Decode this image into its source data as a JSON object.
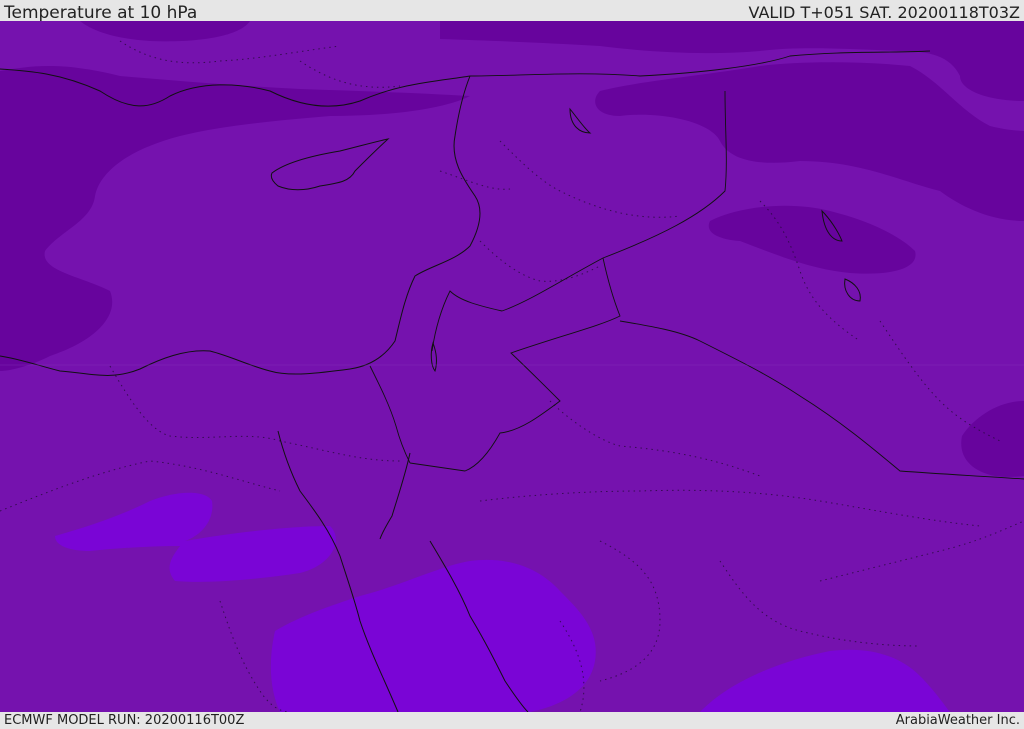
{
  "header": {
    "title": "Temperature at 10 hPa",
    "valid_time": "VALID T+051 SAT. 20200118T03Z"
  },
  "footer": {
    "model_run": "ECMWF MODEL RUN: 20200116T00Z",
    "credit": "ArabiaWeather Inc."
  },
  "map": {
    "colors": {
      "base": "#7512ae",
      "cold": "#67049d",
      "warm": "#7a05d6",
      "coast": "#111111"
    }
  }
}
